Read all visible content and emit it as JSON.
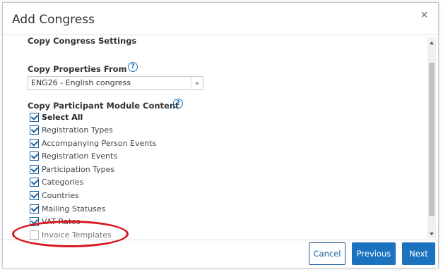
{
  "dialog": {
    "title": "Add Congress",
    "close_glyph": "×"
  },
  "section": {
    "title": "Copy Congress Settings"
  },
  "copy_properties": {
    "label": "Copy Properties From",
    "selected_value": "ENG26 - English congress"
  },
  "copy_participant": {
    "label": "Copy Participant Module Content"
  },
  "help_glyph": "?",
  "checkbox_items": [
    {
      "label": "Select All",
      "checked": true
    },
    {
      "label": "Registration Types",
      "checked": true
    },
    {
      "label": "Accompanying Person Events",
      "checked": true
    },
    {
      "label": "Registration Events",
      "checked": true
    },
    {
      "label": "Participation Types",
      "checked": true
    },
    {
      "label": "Categories",
      "checked": true
    },
    {
      "label": "Countries",
      "checked": true
    },
    {
      "label": "Mailing Statuses",
      "checked": true
    },
    {
      "label": "VAT Rates",
      "checked": true
    },
    {
      "label": "Invoice Templates",
      "checked": false
    }
  ],
  "footer": {
    "cancel_label": "Cancel",
    "previous_label": "Previous",
    "next_label": "Next"
  },
  "colors": {
    "accent": "#1b72be",
    "annotation": "#d9141b"
  }
}
